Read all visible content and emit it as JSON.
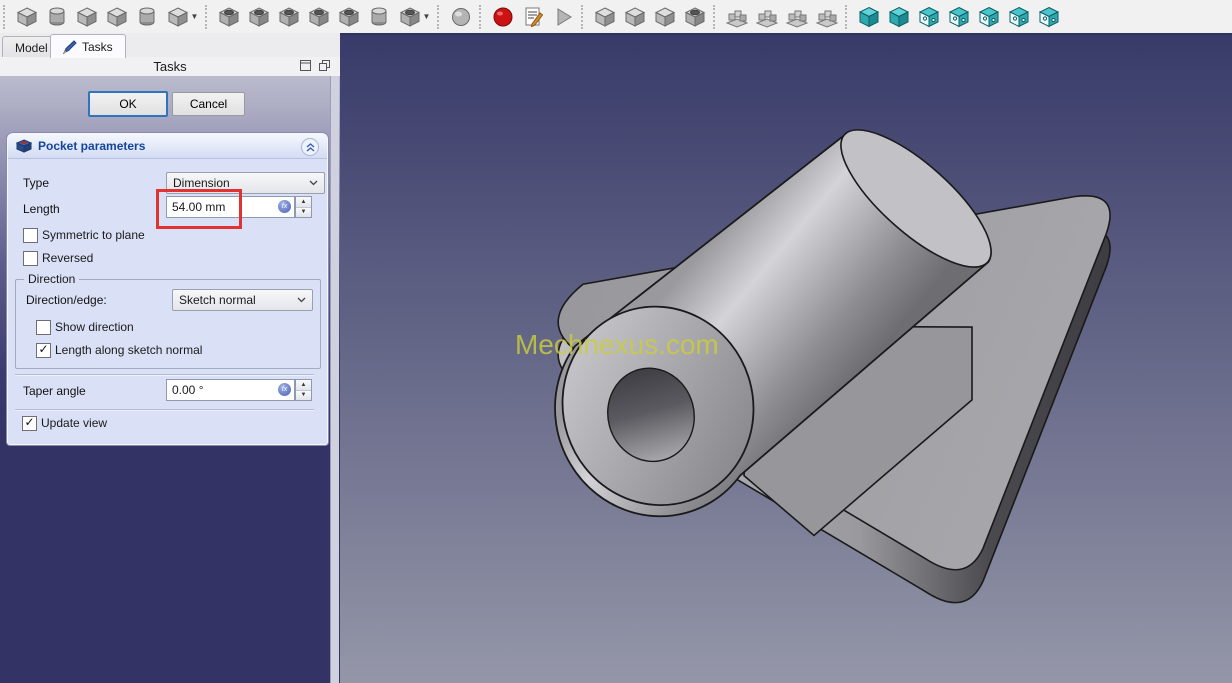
{
  "toolbar": {
    "groups": [
      {
        "icons": [
          {
            "name": "pad",
            "sym": "cube"
          },
          {
            "name": "revolution",
            "sym": "cyl"
          },
          {
            "name": "additive-loft",
            "sym": "cube"
          },
          {
            "name": "additive-pipe",
            "sym": "cube"
          },
          {
            "name": "additive-helix",
            "sym": "cyl"
          },
          {
            "name": "additive-primitive",
            "sym": "cube",
            "dd": true
          }
        ]
      },
      {
        "icons": [
          {
            "name": "pocket",
            "sym": "cube-hole"
          },
          {
            "name": "hole",
            "sym": "cube-hole"
          },
          {
            "name": "groove",
            "sym": "cube-hole"
          },
          {
            "name": "subtractive-loft",
            "sym": "cube-hole"
          },
          {
            "name": "subtractive-pipe",
            "sym": "cube-hole"
          },
          {
            "name": "subtractive-helix",
            "sym": "cyl"
          },
          {
            "name": "subtractive-primitive",
            "sym": "cube-hole",
            "dd": true
          }
        ]
      },
      {
        "icons": [
          {
            "name": "boolean-operation",
            "sym": "sphere"
          }
        ]
      },
      {
        "icons": [
          {
            "name": "macro-record",
            "sym": "record"
          },
          {
            "name": "macro-edit",
            "sym": "macro"
          },
          {
            "name": "macro-execute",
            "sym": "play"
          }
        ]
      },
      {
        "icons": [
          {
            "name": "fillet",
            "sym": "cube"
          },
          {
            "name": "chamfer",
            "sym": "cube"
          },
          {
            "name": "draft",
            "sym": "cube"
          },
          {
            "name": "thickness",
            "sym": "cube-hole"
          }
        ]
      },
      {
        "icons": [
          {
            "name": "mirrored",
            "sym": "pattern"
          },
          {
            "name": "linear-pattern",
            "sym": "pattern"
          },
          {
            "name": "polar-pattern",
            "sym": "pattern"
          },
          {
            "name": "multi-transform",
            "sym": "pattern"
          }
        ]
      },
      {
        "icons": [
          {
            "name": "view-cube-1",
            "sym": "teal"
          },
          {
            "name": "view-cube-2",
            "sym": "teal"
          },
          {
            "name": "view-cube-3",
            "sym": "teal-wire"
          },
          {
            "name": "view-cube-4",
            "sym": "teal-wire"
          },
          {
            "name": "view-cube-5",
            "sym": "teal-wire"
          },
          {
            "name": "view-cube-6",
            "sym": "teal-wire"
          },
          {
            "name": "view-cube-7",
            "sym": "teal-wire"
          }
        ]
      }
    ]
  },
  "tabs": {
    "model": "Model",
    "tasks": "Tasks"
  },
  "tasks_panel": {
    "title": "Tasks",
    "ok_label": "OK",
    "cancel_label": "Cancel"
  },
  "pocket_dialog": {
    "title": "Pocket parameters",
    "type_label": "Type",
    "type_value": "Dimension",
    "length_label": "Length",
    "length_value": "54.00 mm",
    "symmetric_label": "Symmetric to plane",
    "symmetric_check": "",
    "reversed_label": "Reversed",
    "reversed_check": "",
    "direction_group": {
      "title": "Direction",
      "direction_edge_label": "Direction/edge:",
      "direction_edge_value": "Sketch normal",
      "show_direction_label": "Show direction",
      "show_direction_check": "",
      "length_along_label": "Length along sketch normal",
      "length_along_check": "✓"
    },
    "taper_label": "Taper angle",
    "taper_value": "0.00 °",
    "update_view_label": "Update view",
    "update_view_check": "✓",
    "highlight_color": "#e23333"
  },
  "viewport": {
    "watermark": "Mechnexus.com",
    "watermark_color": "#cbcd3c",
    "bg_top": "#383a69",
    "bg_bottom": "#9496a8",
    "part_outline": "#1a1a1a"
  }
}
